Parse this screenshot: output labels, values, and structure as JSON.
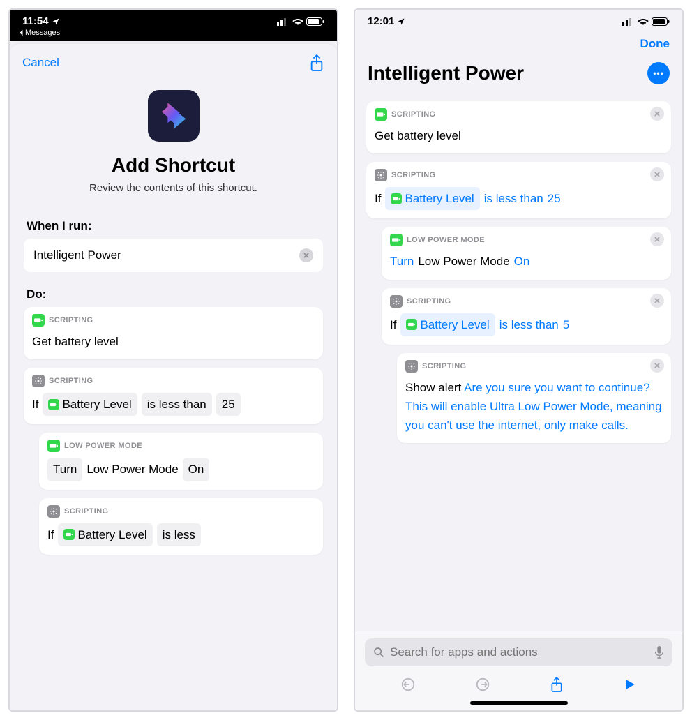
{
  "left": {
    "status": {
      "time": "11:54",
      "back_app": "Messages"
    },
    "nav": {
      "cancel": "Cancel"
    },
    "headline": "Add Shortcut",
    "subhead": "Review the contents of this shortcut.",
    "when_label": "When I run:",
    "shortcut_name": "Intelligent Power",
    "do_label": "Do:",
    "actions": [
      {
        "header": "SCRIPTING",
        "icon": "green",
        "body_plain": "Get battery level"
      },
      {
        "header": "SCRIPTING",
        "icon": "grey",
        "if_label": "If",
        "var": "Battery Level",
        "cond": "is less than",
        "val": "25"
      },
      {
        "header": "LOW POWER MODE",
        "icon": "green",
        "nested": true,
        "turn": "Turn",
        "mode": "Low Power Mode",
        "state": "On"
      },
      {
        "header": "SCRIPTING",
        "icon": "grey",
        "nested": true,
        "if_label": "If",
        "var": "Battery Level",
        "cond": "is less"
      }
    ]
  },
  "right": {
    "status": {
      "time": "12:01"
    },
    "nav": {
      "done": "Done"
    },
    "title": "Intelligent Power",
    "actions": [
      {
        "header": "SCRIPTING",
        "icon": "green",
        "body_plain": "Get battery level"
      },
      {
        "header": "SCRIPTING",
        "icon": "grey",
        "if_label": "If",
        "var": "Battery Level",
        "cond": "is less than",
        "val": "25"
      },
      {
        "header": "LOW POWER MODE",
        "icon": "green",
        "nested": true,
        "turn": "Turn",
        "mode": "Low Power Mode",
        "state": "On"
      },
      {
        "header": "SCRIPTING",
        "icon": "grey",
        "nested": true,
        "if_label": "If",
        "var": "Battery Level",
        "cond": "is less than",
        "val": "5"
      },
      {
        "header": "SCRIPTING",
        "icon": "grey",
        "nested2": true,
        "show": "Show alert",
        "alert": "Are you sure you want to continue? This will enable Ultra Low Power Mode, meaning you can't use the internet, only make calls."
      }
    ],
    "search_placeholder": "Search for apps and actions"
  }
}
